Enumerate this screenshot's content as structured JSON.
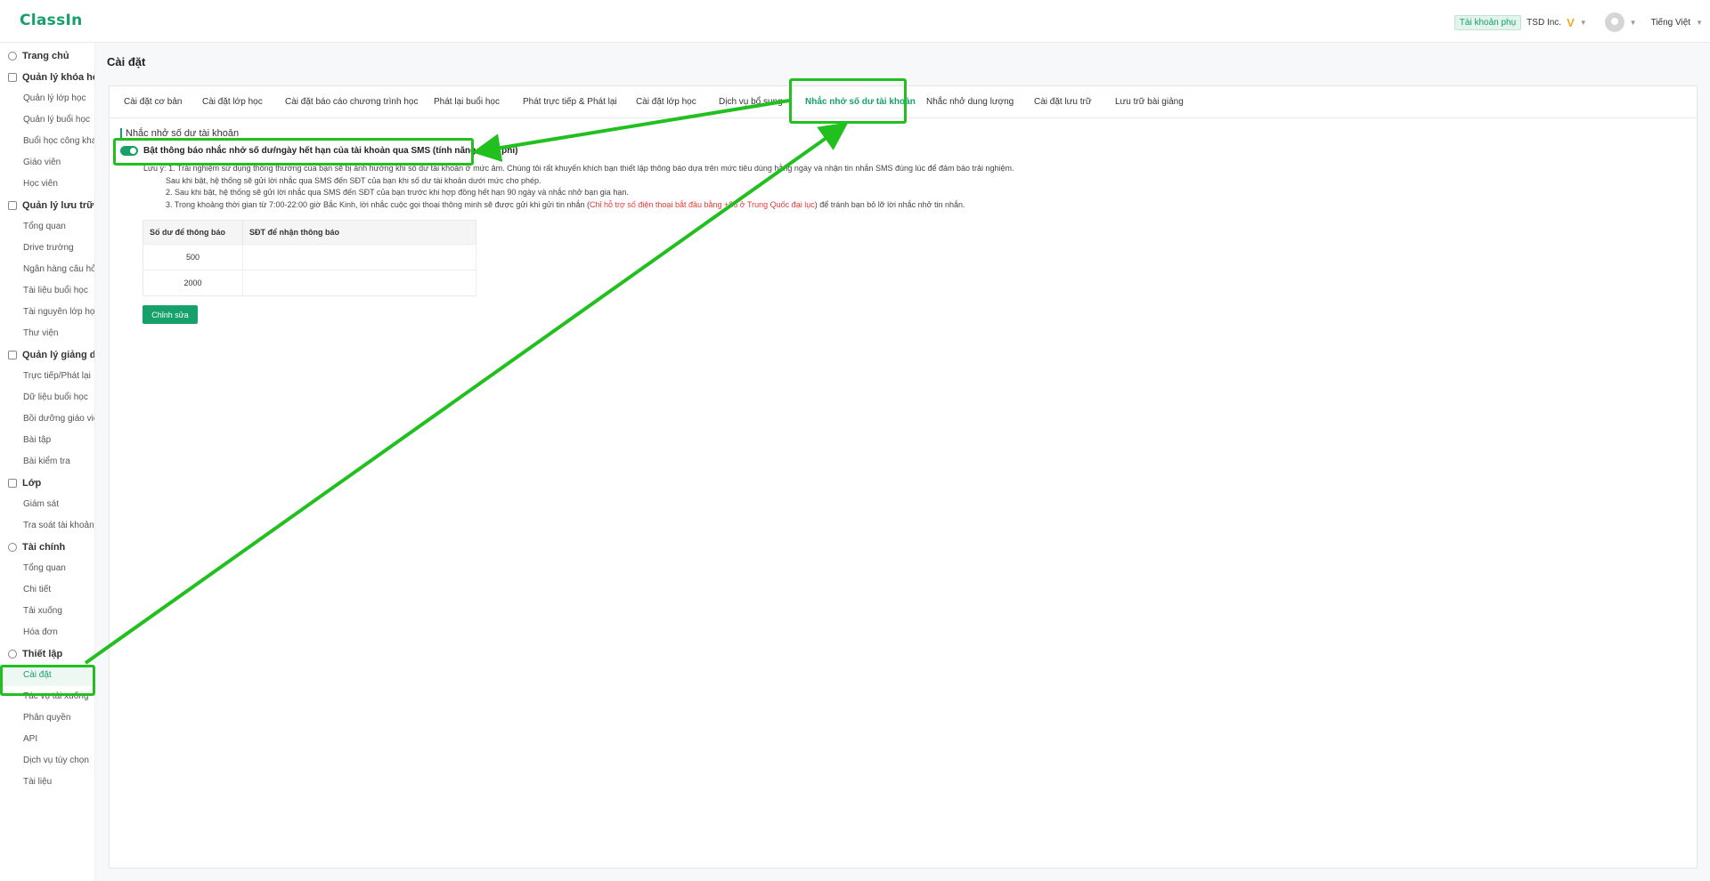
{
  "app": {
    "logo": "ClassIn"
  },
  "topbar": {
    "sub_account_badge": "Tài khoản phụ",
    "org_name": "TSD Inc.",
    "vip_mark": "V",
    "language": "Tiếng Việt"
  },
  "sidebar": {
    "sections": [
      {
        "label": "Trang chủ",
        "icon": "home-icon",
        "items": []
      },
      {
        "label": "Quản lý khóa học",
        "icon": "course-icon",
        "items": [
          "Quản lý lớp học",
          "Quản lý buổi học",
          "Buổi học công khai",
          "Giáo viên",
          "Học viên"
        ]
      },
      {
        "label": "Quản lý lưu trữ",
        "icon": "cloud-icon",
        "items": [
          "Tổng quan",
          "Drive trường",
          "Ngân hàng câu hỏi",
          "Tài liệu buổi học",
          "Tài nguyên lớp học",
          "Thư viện"
        ]
      },
      {
        "label": "Quản lý giảng dạy",
        "icon": "teaching-icon",
        "items": [
          "Trực tiếp/Phát lại",
          "Dữ liệu buổi học",
          "Bồi dưỡng giáo viên",
          "Bài tập",
          "Bài kiểm tra"
        ]
      },
      {
        "label": "Lớp",
        "icon": "class-icon",
        "items": [
          "Giám sát",
          "Tra soát tài khoản"
        ]
      },
      {
        "label": "Tài chính",
        "icon": "finance-icon",
        "items": [
          "Tổng quan",
          "Chi tiết",
          "Tải xuống",
          "Hóa đơn"
        ]
      },
      {
        "label": "Thiết lập",
        "icon": "settings-icon",
        "items": [
          "Cài đặt",
          "Tác vụ tải xuống",
          "Phân quyền",
          "API",
          "Dịch vụ tùy chọn",
          "Tài liệu"
        ]
      }
    ],
    "active_item": "Cài đặt"
  },
  "page": {
    "title": "Cài đặt"
  },
  "tabs": [
    "Cài đặt cơ bản",
    "Cài đặt lớp học",
    "Cài đặt báo cáo chương trình học",
    "Phát lại buổi học",
    "Phát trực tiếp & Phát lại",
    "Cài đặt lớp học",
    "Dịch vụ bổ sung",
    "Nhắc nhở số dư tài khoản",
    "Nhắc nhở dung lượng",
    "Cài đặt lưu trữ",
    "Lưu trữ bài giảng"
  ],
  "active_tab": "Nhắc nhở số dư tài khoản",
  "content": {
    "section_title": "Nhắc nhở số dư tài khoản",
    "toggle_label": "Bật thông báo nhắc nhở số dư/ngày hết hạn của tài khoản qua SMS (tính năng miễn phí)",
    "toggle_on": true,
    "note_prefix": "Lưu ý:",
    "note_1": "1. Trải nghiệm sử dụng thông thường của bạn sẽ bị ảnh hưởng khi số dư tài khoản ở mức âm. Chúng tôi rất khuyến khích bạn thiết lập thông báo dựa trên mức tiêu dùng hằng ngày và nhận tin nhắn SMS đúng lúc để đảm bảo trải nghiệm.",
    "note_1b": "Sau khi bật, hệ thống sẽ gửi lời nhắc qua SMS đến SĐT của bạn khi số dư tài khoản dưới mức cho phép.",
    "note_2": "2. Sau khi bật, hệ thống sẽ gửi lời nhắc qua SMS đến SĐT của bạn trước khi hợp đồng hết hạn 90 ngày và nhắc nhở bạn gia hạn.",
    "note_3_pre": "3. Trong khoảng thời gian từ 7:00-22:00 giờ Bắc Kinh, lời nhắc cuộc gọi thoại thông minh sẽ được gửi khi gửi tin nhắn (",
    "note_3_red": "Chỉ hỗ trợ số điện thoại bắt đầu bằng +86 ở Trung Quốc đại lục",
    "note_3_post": ") để tránh bạn bỏ lỡ lời nhắc nhở tin nhắn.",
    "table": {
      "headers": [
        "Số dư để thông báo",
        "SĐT để nhận thông báo"
      ],
      "rows": [
        [
          "500",
          ""
        ],
        [
          "2000",
          ""
        ]
      ]
    },
    "edit_button": "Chỉnh sửa"
  },
  "colors": {
    "accent": "#16a06a",
    "annotation": "#22c01e",
    "warning": "#e53935"
  }
}
